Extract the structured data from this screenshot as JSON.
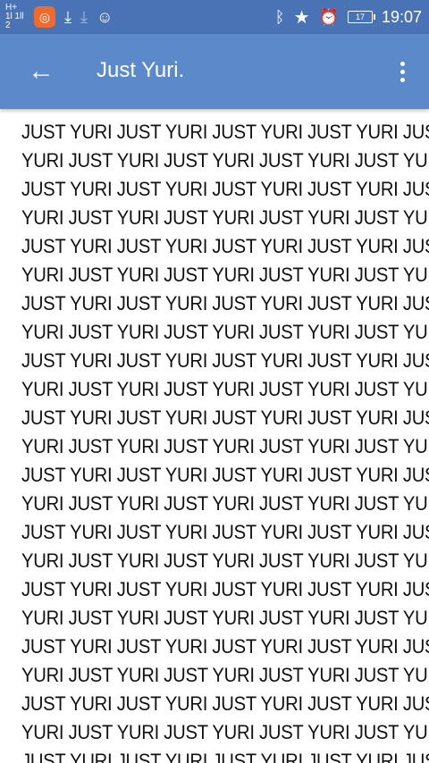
{
  "status_bar": {
    "signal_text": "H+ 1l 1ll 2",
    "time": "19:07",
    "battery": "17"
  },
  "app_bar": {
    "title": "Just Yuri."
  },
  "content": {
    "lines": [
      "JUST YURI JUST YURI JUST YURI JUST YURI JUST",
      "YURI JUST YURI JUST YURI JUST YURI JUST YURI",
      "JUST YURI JUST YURI JUST YURI JUST YURI JUST",
      "YURI JUST YURI JUST YURI JUST YURI JUST YURI",
      "JUST YURI JUST YURI JUST YURI JUST YURI JUST",
      "YURI JUST YURI JUST YURI JUST YURI JUST YURI",
      "JUST YURI JUST YURI JUST YURI JUST YURI JUST",
      "YURI JUST YURI JUST YURI JUST YURI JUST YURI",
      "JUST YURI JUST YURI JUST YURI JUST YURI JUST",
      "YURI JUST YURI JUST YURI JUST YURI JUST YURI",
      "JUST YURI JUST YURI JUST YURI JUST YURI JUST",
      "YURI JUST YURI JUST YURI JUST YURI JUST YURI",
      "JUST YURI JUST YURI JUST YURI JUST YURI JUST",
      "YURI JUST YURI JUST YURI JUST YURI JUST YURI",
      "JUST YURI JUST YURI JUST YURI JUST YURI JUST",
      "YURI JUST YURI JUST YURI JUST YURI JUST YURI",
      "JUST YURI JUST YURI JUST YURI JUST YURI JUST",
      "YURI JUST YURI JUST YURI JUST YURI JUST YURI",
      "JUST YURI JUST YURI JUST YURI JUST YURI JUST",
      "YURI JUST YURI JUST YURI JUST YURI JUST YURI",
      "JUST YURI JUST YURI JUST YURI JUST YURI JUST",
      "YURI JUST YURI JUST YURI JUST YURI JUST YURI",
      "JUST YURI JUST YURI JUST YURI JUST YURI JUST"
    ]
  },
  "icons": {
    "app": "app-icon",
    "download": "download-icon",
    "download_dim": "download-icon",
    "chat": "chat-bubble-icon",
    "bluetooth": "bluetooth-icon",
    "star": "star-icon",
    "alarm": "alarm-icon",
    "back": "back-arrow-icon",
    "more": "more-vertical-icon"
  },
  "colors": {
    "status_bar": "#4a73b6",
    "app_bar": "#5b89c9",
    "text": "#111111",
    "background": "#ffffff"
  }
}
